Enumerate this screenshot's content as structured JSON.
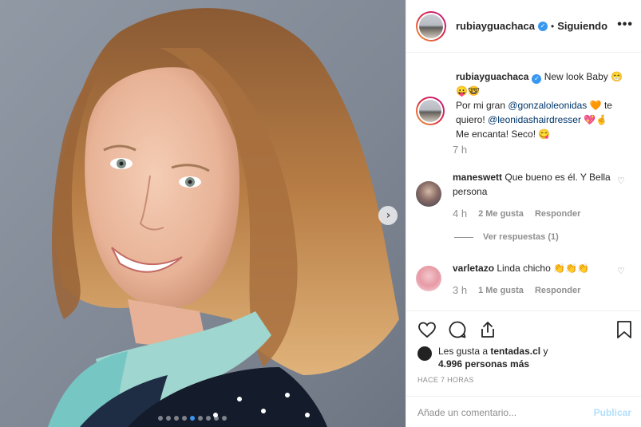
{
  "post": {
    "username": "rubiayguachaca",
    "follow_status": "Siguiendo",
    "separator": "•",
    "more": "•••",
    "caption_text": "New look Baby",
    "caption_emoji": "😁",
    "caption_line2_emoji": "😛🤓",
    "caption_by": "Por mi gran",
    "caption_mention1": "@gonzaloleonidas",
    "caption_heart": "🧡",
    "caption_te": "te quiero!",
    "caption_mention2": "@leonidashairdresser",
    "caption_end_emoji": "💖🤞",
    "caption_end": "Me encanta! Seco!",
    "caption_end_emoji2": "😋",
    "caption_time": "7 h"
  },
  "comments": [
    {
      "username": "maneswett",
      "text": "Que bueno es él. Y Bella persona",
      "time": "4 h",
      "likes": "2 Me gusta",
      "reply": "Responder"
    },
    {
      "username": "varletazo",
      "text": "Linda chicho",
      "emoji": "👏👏👏",
      "time": "3 h",
      "likes": "1 Me gusta",
      "reply": "Responder"
    }
  ],
  "view_replies": "Ver respuestas (1)",
  "likes": {
    "prefix": "Les gusta a",
    "user": "tentadas.cl",
    "suffix": "y",
    "count": "4.996 personas más"
  },
  "posted_ago": "HACE 7 HORAS",
  "add_comment": {
    "placeholder": "Añade un comentario...",
    "submit": "Publicar"
  },
  "carousel": {
    "total": 9,
    "active_index": 4
  },
  "colors": {
    "link": "#003569",
    "verified": "#3897f0",
    "publish": "#b2dffc",
    "muted": "#8e8e8e"
  },
  "icons": [
    "heart-icon",
    "comment-icon",
    "share-icon",
    "bookmark-icon",
    "chevron-right-icon",
    "verified-icon",
    "more-icon"
  ]
}
